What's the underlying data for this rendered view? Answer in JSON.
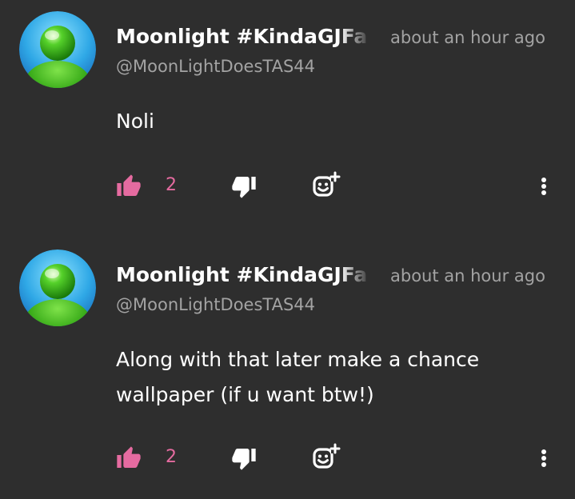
{
  "comments": [
    {
      "display_name": "Moonlight #KindaGJFa",
      "timestamp": "about an hour ago",
      "handle": "@MoonLightDoesTAS44",
      "body": "Noli",
      "like_count": "2",
      "avatar_icon": "green-orb-user-avatar-icon"
    },
    {
      "display_name": "Moonlight #KindaGJFa",
      "timestamp": "about an hour ago",
      "handle": "@MoonLightDoesTAS44",
      "body": "Along with that later make a chance wallpaper (if u want btw!)",
      "like_count": "2",
      "avatar_icon": "green-orb-user-avatar-icon"
    }
  ],
  "icons": {
    "like": "thumbs-up-icon",
    "dislike": "thumbs-down-icon",
    "react": "add-reaction-icon",
    "more": "more-vertical-icon"
  },
  "colors": {
    "background": "#2e2e2e",
    "text_primary": "#ffffff",
    "text_secondary": "#a3a3a3",
    "accent_liked": "#e56ba0",
    "icon_default": "#ffffff"
  }
}
